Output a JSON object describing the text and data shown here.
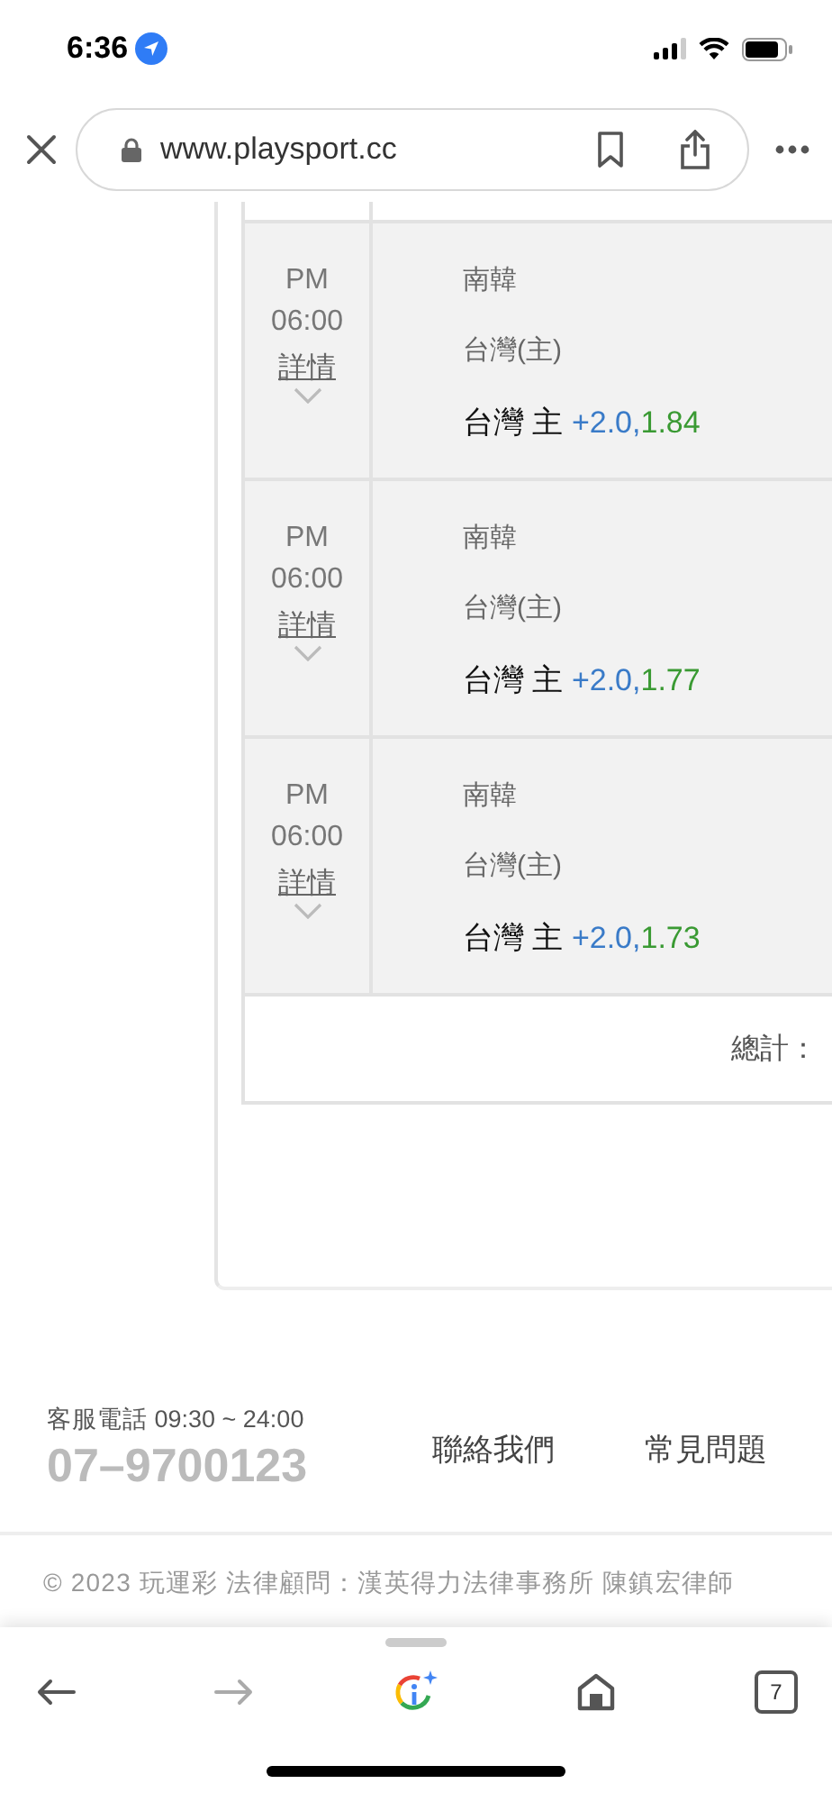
{
  "status_bar": {
    "time": "6:36"
  },
  "address_bar": {
    "url": "www.playsport.cc"
  },
  "matches": [
    {
      "ampm": "PM",
      "time": "06:00",
      "details_link": "詳情",
      "away": "南韓",
      "home": "台灣(主)",
      "pick": "台灣 主",
      "line": "+2.0,",
      "odds": "1.84"
    },
    {
      "ampm": "PM",
      "time": "06:00",
      "details_link": "詳情",
      "away": "南韓",
      "home": "台灣(主)",
      "pick": "台灣 主",
      "line": "+2.0,",
      "odds": "1.77"
    },
    {
      "ampm": "PM",
      "time": "06:00",
      "details_link": "詳情",
      "away": "南韓",
      "home": "台灣(主)",
      "pick": "台灣 主",
      "line": "+2.0,",
      "odds": "1.73"
    }
  ],
  "total_label": "總計：",
  "footer": {
    "hotline_label": "客服電話 09:30 ~ 24:00",
    "phone": "07–9700123",
    "links": [
      "聯絡我們",
      "常見問題"
    ],
    "copyright": "© 2023 玩運彩 法律顧問：漢英得力法律事務所 陳鎮宏律師"
  },
  "toolbar": {
    "tab_count": "7"
  }
}
